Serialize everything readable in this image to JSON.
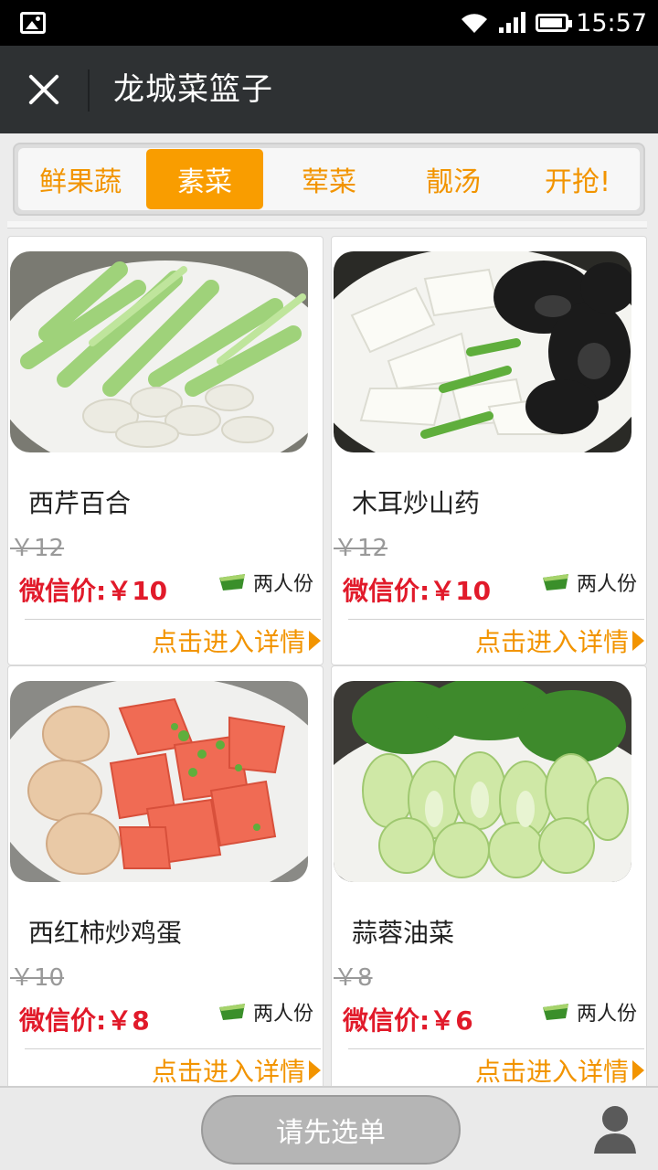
{
  "status_bar": {
    "time": "15:57"
  },
  "header": {
    "title": "龙城菜篮子"
  },
  "tabs": [
    {
      "label": "鲜果蔬",
      "active": false
    },
    {
      "label": "素菜",
      "active": true
    },
    {
      "label": "荤菜",
      "active": false
    },
    {
      "label": "靓汤",
      "active": false
    },
    {
      "label": "开抢!",
      "active": false
    }
  ],
  "products": [
    {
      "name": "西芹百合",
      "old_price": "￥12",
      "wx_price": "微信价:￥10",
      "serving": "两人份",
      "detail": "点击进入详情"
    },
    {
      "name": "木耳炒山药",
      "old_price": "￥12",
      "wx_price": "微信价:￥10",
      "serving": "两人份",
      "detail": "点击进入详情"
    },
    {
      "name": "西红柿炒鸡蛋",
      "old_price": "￥10",
      "wx_price": "微信价:￥8",
      "serving": "两人份",
      "detail": "点击进入详情"
    },
    {
      "name": "蒜蓉油菜",
      "old_price": "￥8",
      "wx_price": "微信价:￥6",
      "serving": "两人份",
      "detail": "点击进入详情"
    }
  ],
  "bottom": {
    "order_button": "请先选单"
  },
  "colors": {
    "accent": "#f99d00",
    "price_red": "#e11a2a",
    "header_bg": "#2e3133"
  }
}
